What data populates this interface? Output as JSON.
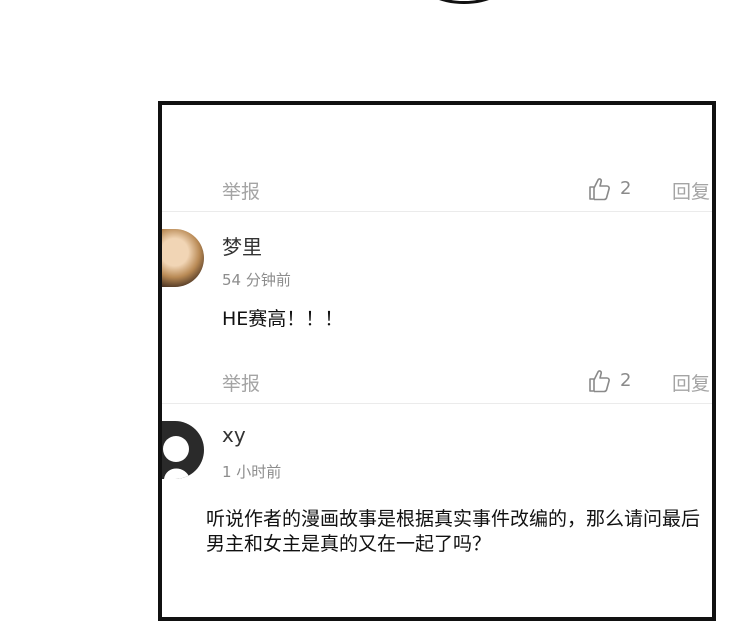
{
  "comments": [
    {
      "actions": {
        "report": "举报",
        "like_count": "2",
        "reply": "回复"
      }
    },
    {
      "username": "梦里",
      "time": "54 分钟前",
      "content": "HE赛高！！！",
      "actions": {
        "report": "举报",
        "like_count": "2",
        "reply": "回复"
      }
    },
    {
      "username": "xy",
      "time": "1 小时前",
      "content": "听说作者的漫画故事是根据真实事件改编的，那么请问最后男主和女主是真的又在一起了吗？"
    }
  ],
  "icons": {
    "like": "thumbs-up-icon",
    "avatar_1": "user-photo",
    "avatar_2": "default-avatar-icon"
  },
  "colors": {
    "muted": "#a4a4a4",
    "frame": "#111111"
  }
}
